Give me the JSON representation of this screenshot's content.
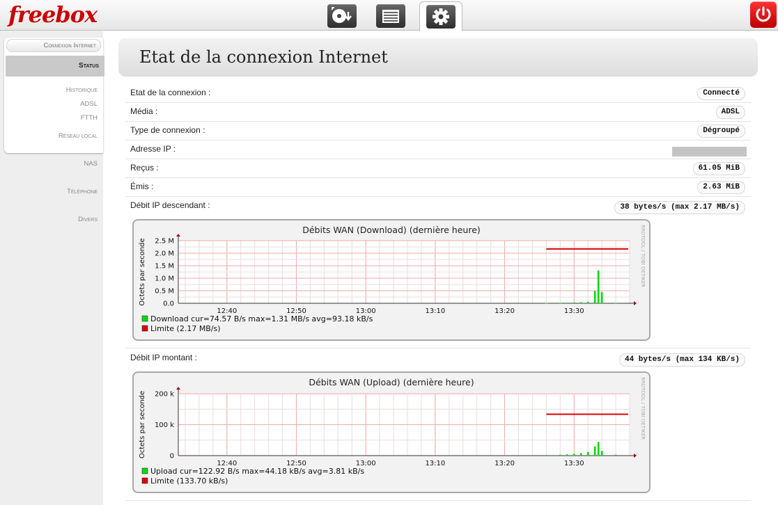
{
  "brand": {
    "logo_text": "freebox"
  },
  "topbar": {
    "icons": [
      "download-icon",
      "list-icon",
      "gear-icon",
      "power-icon"
    ]
  },
  "sidebar": {
    "group_title": "Connexion Internet",
    "active": "Status",
    "sub_items": [
      "Historique",
      "ADSL",
      "FTTH"
    ],
    "items": [
      "Réseau local",
      "NAS",
      "Téléphone",
      "Divers"
    ]
  },
  "page": {
    "title": "Etat de la connexion Internet"
  },
  "fields": [
    {
      "label": "Etat de la connexion :",
      "value": "Connecté"
    },
    {
      "label": "Média :",
      "value": "ADSL"
    },
    {
      "label": "Type de connexion :",
      "value": "Dégroupé"
    },
    {
      "label": "Adresse IP :",
      "value": ""
    },
    {
      "label": "Reçus :",
      "value": "61.05 MiB"
    },
    {
      "label": "Émis :",
      "value": "2.63 MiB"
    },
    {
      "label": "Débit IP descendant :",
      "value": "38 bytes/s (max 2.17 MB/s)"
    },
    {
      "label": "Débit IP montant :",
      "value": "44 bytes/s (max 134 KB/s)"
    }
  ],
  "chart_data": [
    {
      "type": "area",
      "title": "Débits WAN (Download)  (dernière heure)",
      "ylabel": "Octets par seconde",
      "watermark": "RRDTOOL / TOBI OETIKER",
      "x_ticks": [
        "12:40",
        "12:50",
        "13:00",
        "13:10",
        "13:20",
        "13:30"
      ],
      "y_ticks": [
        "2.5 M",
        "2.0 M",
        "1.5 M",
        "1.0 M",
        "0.5 M",
        "0.0"
      ],
      "ylim": [
        0,
        2500000
      ],
      "series": [
        {
          "name": "Download",
          "color": "#00dd00",
          "x": [
            "13:26",
            "13:28",
            "13:29",
            "13:30",
            "13:31",
            "13:32",
            "13:33",
            "13:33.5",
            "13:34",
            "13:36"
          ],
          "values": [
            15000,
            20000,
            25000,
            30000,
            40000,
            60000,
            500000,
            1310000,
            450000,
            20000
          ]
        },
        {
          "name": "Limite",
          "color": "#dd0000",
          "start": "13:26",
          "value": 2170000
        }
      ],
      "legend": [
        {
          "color": "#00dd00",
          "text": "Download    cur=74.57  B/s     max=1.31 MB/s     avg=93.18 kB/s"
        },
        {
          "color": "#dd0000",
          "text": "Limite      (2.17 MB/s)"
        }
      ]
    },
    {
      "type": "area",
      "title": "Débits WAN (Upload)  (dernière heure)",
      "ylabel": "Octets par seconde",
      "watermark": "RRDTOOL / TOBI OETIKER",
      "x_ticks": [
        "12:40",
        "12:50",
        "13:00",
        "13:10",
        "13:20",
        "13:30"
      ],
      "y_ticks": [
        "200 k",
        "100 k",
        "0"
      ],
      "ylim": [
        0,
        200000
      ],
      "series": [
        {
          "name": "Upload",
          "color": "#00dd00",
          "x": [
            "13:26",
            "13:28",
            "13:29",
            "13:30",
            "13:31",
            "13:32",
            "13:33",
            "13:33.5",
            "13:34",
            "13:36"
          ],
          "values": [
            2000,
            3000,
            4000,
            5000,
            8000,
            12000,
            30000,
            44180,
            15000,
            3000
          ]
        },
        {
          "name": "Limite",
          "color": "#dd0000",
          "start": "13:26",
          "value": 133700
        }
      ],
      "legend": [
        {
          "color": "#00dd00",
          "text": "Upload    cur=122.92  B/s     max=44.18 kB/s     avg=3.81 kB/s"
        },
        {
          "color": "#dd0000",
          "text": "Limite    (133.70 kB/s)"
        }
      ]
    }
  ]
}
